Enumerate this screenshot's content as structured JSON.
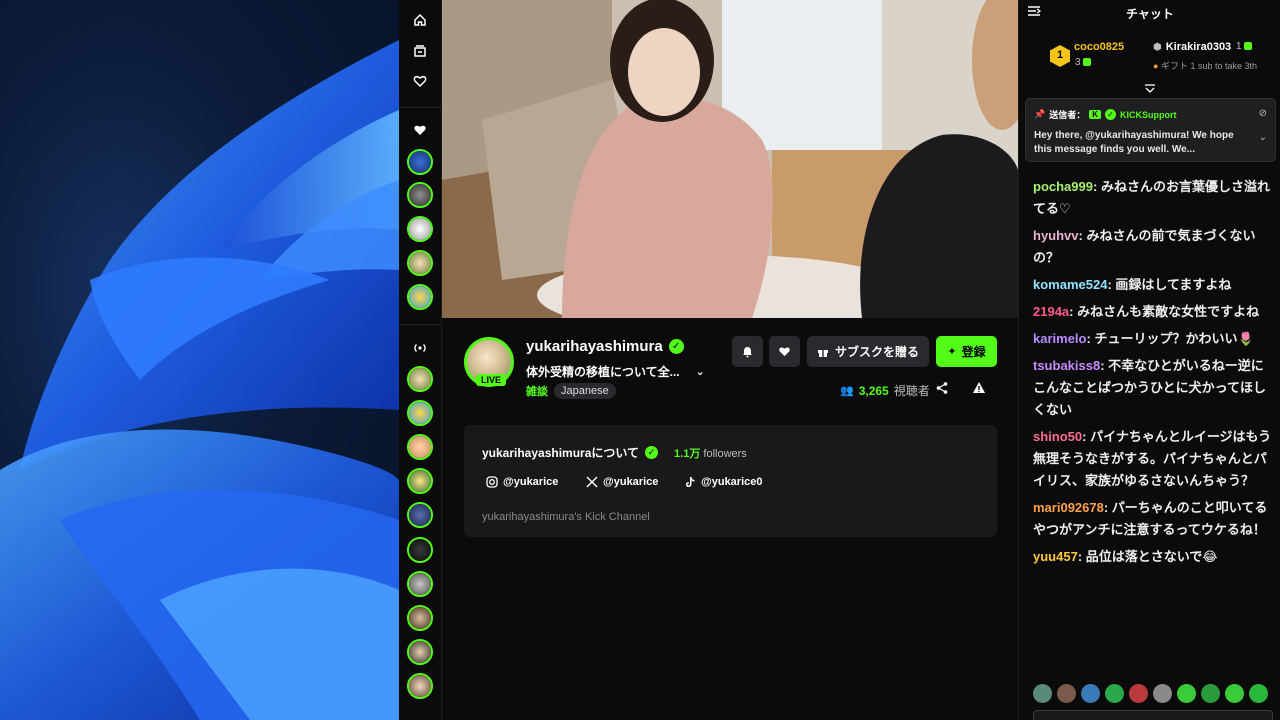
{
  "rail": {
    "home_icon": "home-icon",
    "browse_icon": "browse-icon",
    "following_icon": "heart-icon",
    "section_following_icon": "heart-icon",
    "section_recommended_icon": "broadcast-icon"
  },
  "channel": {
    "name": "yukarihayashimura",
    "live_label": "LIVE",
    "title": "体外受精の移植について全...",
    "category": "雑談",
    "tag": "Japanese",
    "viewers": "3,265",
    "viewers_label": "視聴者"
  },
  "actions": {
    "gift_label": "サブスクを贈る",
    "subscribe_label": "登録"
  },
  "about": {
    "title": "yukarihayashimuraについて",
    "followers_count": "1.1万",
    "followers_label": "followers",
    "instagram": "@yukarice",
    "x": "@yukarice",
    "tiktok": "@yukarice0",
    "description": "yukarihayashimura's Kick Channel"
  },
  "chat": {
    "header": "チャット",
    "leaderboard": {
      "first_rank": "1",
      "first_name": "coco0825",
      "first_count": "3",
      "second_name": "Kirakira0303",
      "second_count": "1",
      "sub_text": "ギフト 1 sub to take 3th"
    },
    "pinned": {
      "label": "送信者：",
      "user": "KICKSupport",
      "message": "Hey there, @yukarihayashimura! We hope this message finds you well. We..."
    },
    "messages": [
      {
        "user": "pocha999",
        "color": "#a6f26a",
        "text": "みねさんのお言葉優しさ溢れてる♡"
      },
      {
        "user": "hyuhvv",
        "color": "#e9b0d4",
        "text": "みねさんの前で気まづくないの？"
      },
      {
        "user": "komame524",
        "color": "#8fe3ff",
        "text": "画録はしてますよね"
      },
      {
        "user": "2194a",
        "color": "#ff5a8a",
        "text": "みねさんも素敵な女性ですよね"
      },
      {
        "user": "karimelo",
        "color": "#b98bff",
        "text": "チューリップ？かわいい🌷"
      },
      {
        "user": "tsubakiss8",
        "color": "#c88bff",
        "text": "不幸なひとがいるねー逆にこんなことばつかうひとに犬かってほしくない"
      },
      {
        "user": "shino50",
        "color": "#ff6f8f",
        "text": "パイナちゃんとルイージはもう無理そうなきがする。パイナちゃんとパイリス、家族がゆるさないんちゃう？"
      },
      {
        "user": "mari092678",
        "color": "#ffa24a",
        "text": "パーちゃんのこと叩いてるやつがアンチに注意するってウケるね！"
      },
      {
        "user": "yuu457",
        "color": "#ffc93c",
        "text": "品位は落とさないで😂"
      }
    ]
  },
  "colors": {
    "accent": "#53fc18",
    "background": "#0b0b0c",
    "panel": "#19191b"
  }
}
